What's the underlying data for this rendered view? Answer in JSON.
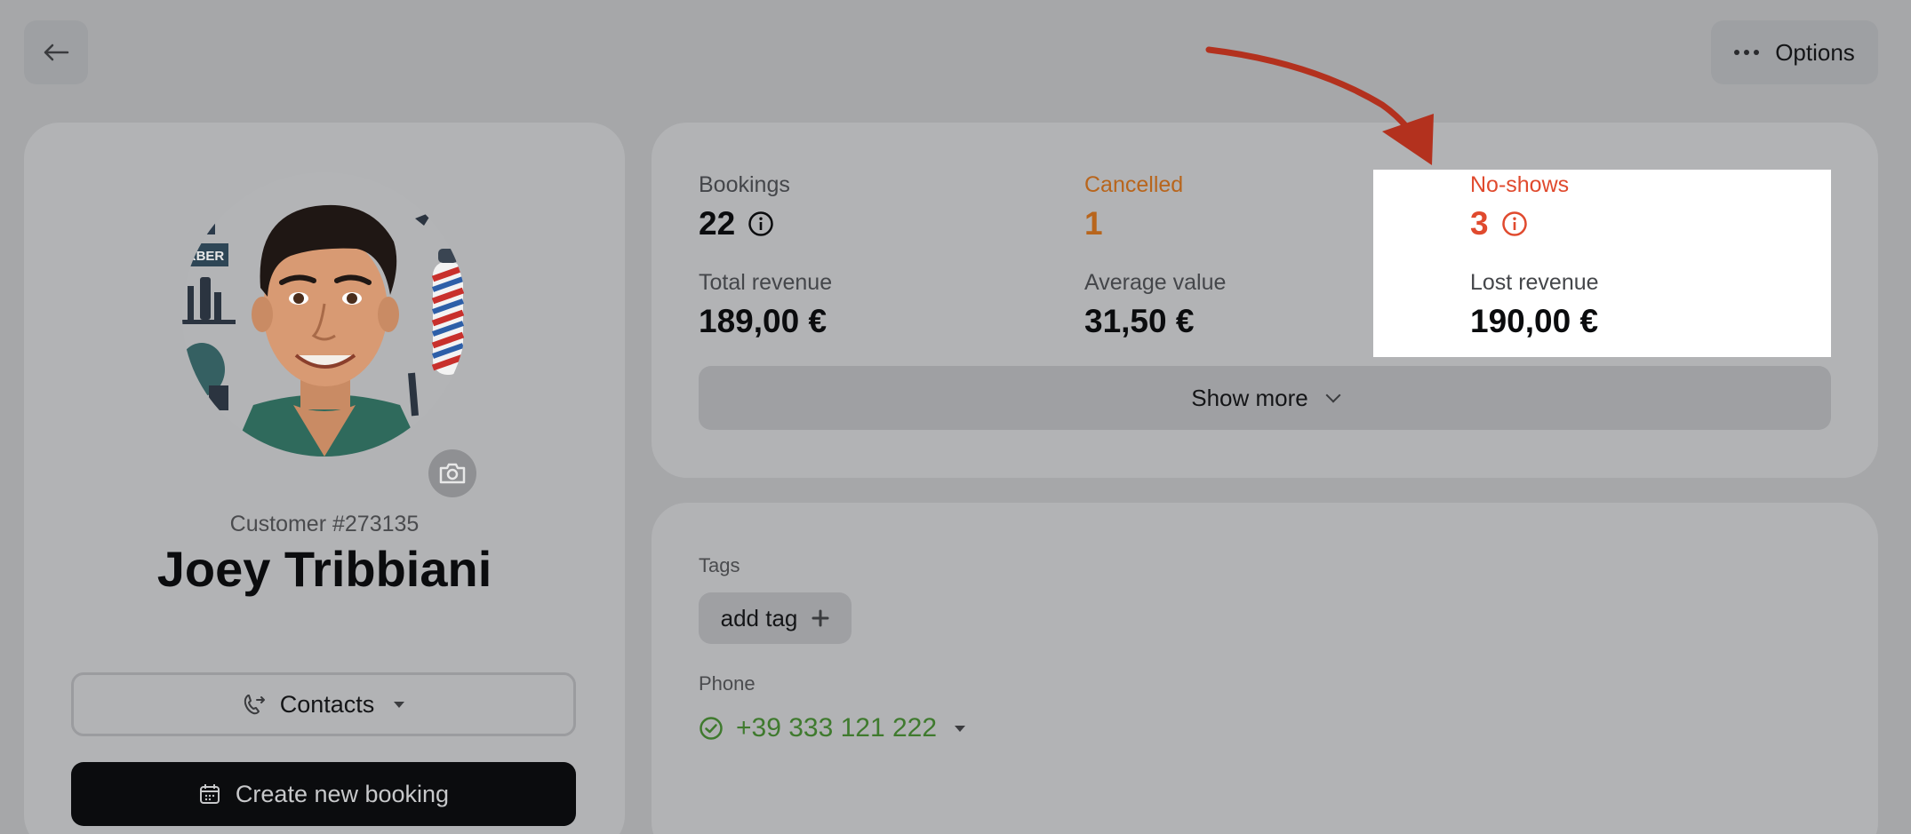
{
  "header": {
    "options_label": "Options"
  },
  "profile": {
    "customer_number": "Customer #273135",
    "name": "Joey Tribbiani",
    "contacts_label": "Contacts",
    "create_booking_label": "Create new booking",
    "avatar_sign_text": "RBER"
  },
  "stats": {
    "bookings": {
      "label": "Bookings",
      "value": "22"
    },
    "cancelled": {
      "label": "Cancelled",
      "value": "1"
    },
    "no_shows": {
      "label": "No-shows",
      "value": "3"
    },
    "total_revenue": {
      "label": "Total revenue",
      "value": "189,00 €"
    },
    "average_value": {
      "label": "Average value",
      "value": "31,50 €"
    },
    "lost_revenue": {
      "label": "Lost revenue",
      "value": "190,00 €"
    },
    "show_more_label": "Show more"
  },
  "details": {
    "tags_label": "Tags",
    "add_tag_label": "add tag",
    "phone_label": "Phone",
    "phone_value": "+39 333 121 222"
  },
  "colors": {
    "cancelled": "#b8651c",
    "no_shows": "#e04a2e",
    "phone": "#3f7a2e",
    "annotation_arrow": "#b3311e"
  },
  "icons": [
    "back-arrow-icon",
    "more-dots-icon",
    "camera-icon",
    "info-icon",
    "contacts-icon",
    "calendar-icon",
    "plus-icon",
    "check-circle-icon",
    "chevron-down-icon"
  ]
}
